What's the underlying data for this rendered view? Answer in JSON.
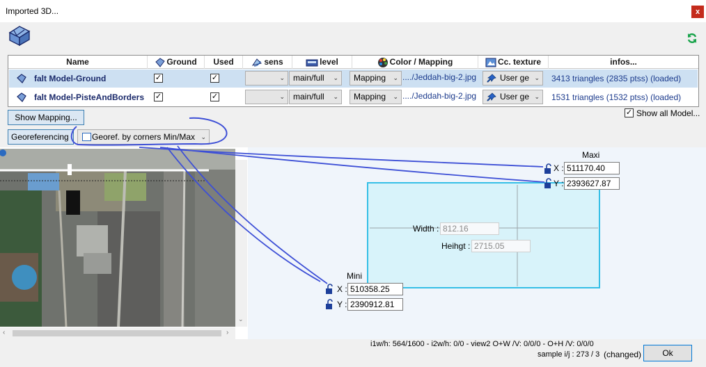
{
  "window": {
    "title": "Imported 3D...",
    "close_glyph": "x"
  },
  "table": {
    "headers": {
      "name": "Name",
      "ground": "Ground",
      "used": "Used",
      "sens": "sens",
      "level": "level",
      "color": "Color / Mapping",
      "texture": "Cc. texture",
      "infos": "infos..."
    },
    "rows": [
      {
        "name": "falt Model-Ground",
        "ground": true,
        "used": true,
        "sens": "",
        "level": "main/full",
        "color": "Mapping",
        "file": "..../Jeddah-big-2.jpg",
        "texture": "User ge",
        "infos": "3413 triangles  (2835 ptss) (loaded)"
      },
      {
        "name": "falt Model-PisteAndBorders",
        "ground": true,
        "used": true,
        "sens": "",
        "level": "main/full",
        "color": "Mapping",
        "file": "..../Jeddah-big-2.jpg",
        "texture": "User ge",
        "infos": "1531 triangles  (1532 ptss) (loaded)"
      }
    ]
  },
  "show_mapping_label": "Show Mapping...",
  "show_all_label": "Show all Model...",
  "show_all_checked": true,
  "georef_label": "Georeferencing :",
  "georef_mode": "Georef. by corners Min/Max",
  "maxi": {
    "title": "Maxi",
    "x_label": "X :",
    "y_label": "Y :",
    "x": "511170.40",
    "y": "2393627.87"
  },
  "mini": {
    "title": "Mini",
    "x_label": "X :",
    "y_label": "Y :",
    "x": "510358.25",
    "y": "2390912.81"
  },
  "width": {
    "label": "Width :",
    "value": "812.16"
  },
  "height": {
    "label": "Heihgt :",
    "value": "2715.05"
  },
  "status": {
    "line1": "i1w/h: 564/1600 - i2w/h: 0/0 - view2 O+W /V: 0/0/0 - O+H /V: 0/0/0",
    "line2": "sample i/j : 273 / 3",
    "changed": "(changed)"
  },
  "ok_label": "Ok",
  "colors": {
    "accent": "#1b3a8c",
    "selection": "#cde0f2",
    "rect_fill": "#d8f3fa",
    "rect_border": "#35bfe6",
    "annotation": "#3d4fd6",
    "refresh": "#17a34a"
  },
  "icons": [
    "app-3d-icon",
    "refresh-icon",
    "ground-icon",
    "sens-icon",
    "level-icon",
    "palette-icon",
    "texture-icon",
    "model-icon",
    "pin-icon",
    "lock-icon"
  ]
}
